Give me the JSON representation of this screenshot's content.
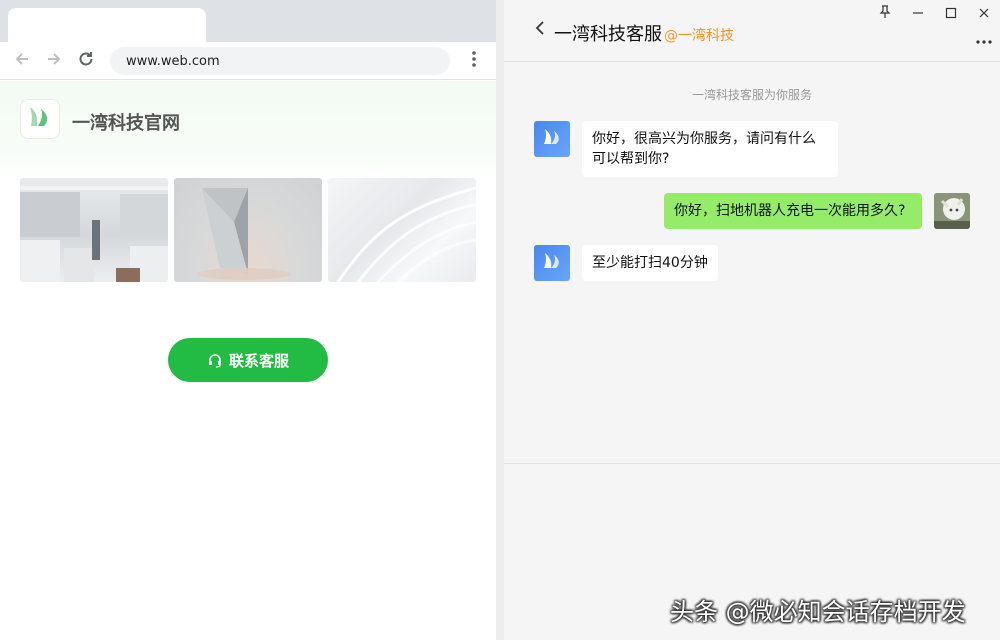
{
  "browser": {
    "url": "www.web.com"
  },
  "site": {
    "title": "一湾科技官网",
    "contact_label": "联系客服"
  },
  "chat": {
    "title": "一湾科技客服",
    "org": "@一湾科技",
    "system_note": "一湾科技客服为你服务",
    "messages": [
      {
        "from": "agent",
        "text": "你好，很高兴为你服务，请问有什么可以帮到你?"
      },
      {
        "from": "user",
        "text": "你好，扫地机器人充电一次能用多久?"
      },
      {
        "from": "agent",
        "text": "至少能打扫40分钟"
      }
    ]
  },
  "watermark": "头条 @微必知会话存档开发",
  "colors": {
    "brand_green": "#22bb44",
    "org_orange": "#f0932b",
    "bubble_out": "#95ec69",
    "bot_avatar": "#4a86ee"
  },
  "icons": [
    "back-arrow-icon",
    "forward-arrow-icon",
    "reload-icon",
    "kebab-menu-icon",
    "headset-icon",
    "pin-icon",
    "minimize-icon",
    "maximize-icon",
    "close-icon",
    "chevron-left-icon",
    "more-icon"
  ]
}
